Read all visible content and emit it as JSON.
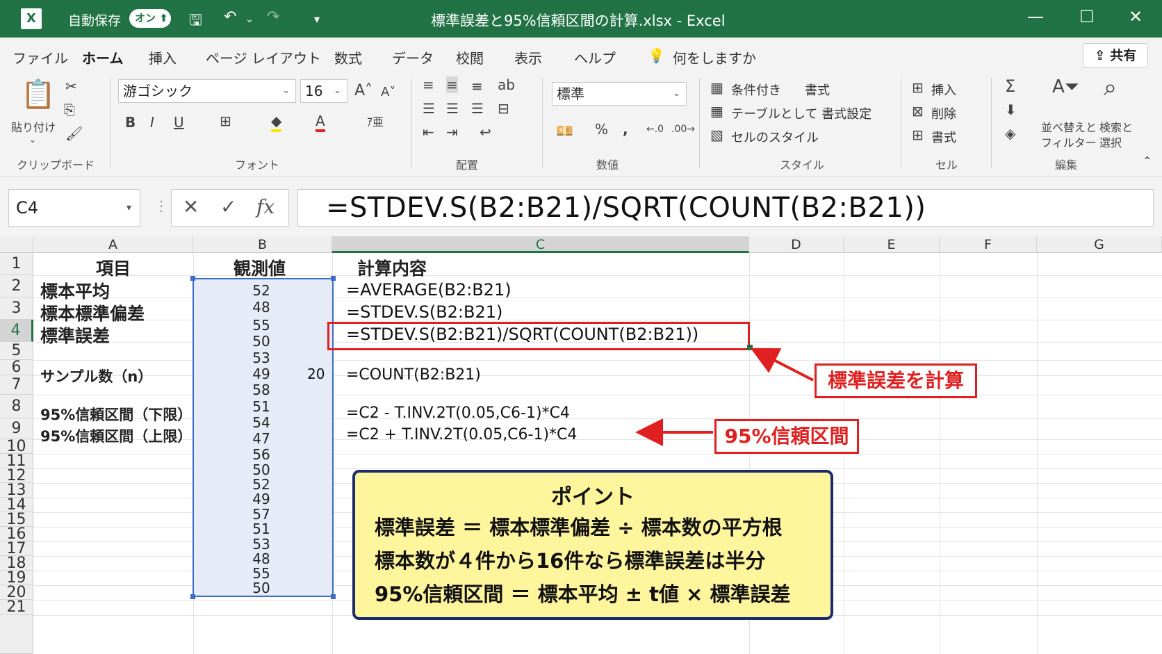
{
  "titlebar": {
    "autosave_label": "自動保存",
    "autosave_toggle": "オン",
    "file_title": "標準誤差と95%信頼区間の計算.xlsx  -  Excel"
  },
  "tabs": [
    "ファイル",
    "ホーム",
    "挿入",
    "ページ レイアウト",
    "数式",
    "データ",
    "校閲",
    "表示",
    "ヘルプ"
  ],
  "tellme": "何をしますか",
  "share_label": "共有",
  "ribbon": {
    "paste_label": "貼り付け",
    "clipboard_label": "クリップボード",
    "font_name": "游ゴシック",
    "font_size": "16",
    "font_group_label": "フォント",
    "align_group_label": "配置",
    "number_format": "標準",
    "number_group_label": "数値",
    "cond_format": "条件付き",
    "format_label": "書式",
    "table_format": "テーブルとして 書式設定",
    "cell_styles": "セルのスタイル",
    "style_group_label": "スタイル",
    "insert_label": "挿入",
    "delete_label": "削除",
    "format_cells_label": "書式",
    "cells_group_label": "セル",
    "sort_filter_1": "並べ替えと",
    "sort_filter_2": "フィルター",
    "find_select_1": "検索と",
    "find_select_2": "選択",
    "edit_group_label": "編集"
  },
  "formula_bar": {
    "namebox": "C4",
    "formula": "=STDEV.S(B2:B21)/SQRT(COUNT(B2:B21))"
  },
  "columns": [
    "A",
    "B",
    "C",
    "D",
    "E",
    "F",
    "G"
  ],
  "rows": [
    "1",
    "2",
    "3",
    "4",
    "5",
    "6",
    "7",
    "8",
    "9",
    "10",
    "11",
    "12",
    "13",
    "14",
    "15",
    "16",
    "17",
    "18",
    "19",
    "20",
    "21"
  ],
  "col_a": {
    "header": "項目",
    "r2": "標本平均",
    "r3": "標本標準偏差",
    "r4": "標準誤差",
    "r6": "サンプル数（n）",
    "r8": "95%信頼区間（下限）",
    "r9": "95%信頼区間（上限）"
  },
  "col_b_header": "観測値",
  "observations": [
    "52",
    "48",
    "55",
    "50",
    "53",
    "49",
    "58",
    "51",
    "54",
    "47",
    "56",
    "50",
    "52",
    "49",
    "57",
    "51",
    "53",
    "48",
    "55",
    "50"
  ],
  "count_value": "20",
  "col_c": {
    "header": "計算内容",
    "r2": "=AVERAGE(B2:B21)",
    "r3": "=STDEV.S(B2:B21)",
    "r4": "=STDEV.S(B2:B21)/SQRT(COUNT(B2:B21))",
    "r6": "=COUNT(B2:B21)",
    "r8": "=C2 - T.INV.2T(0.05,C6-1)*C4",
    "r9": "=C2 + T.INV.2T(0.05,C6-1)*C4"
  },
  "callouts": {
    "se": "標準誤差を計算",
    "ci": "95%信頼区間"
  },
  "point": {
    "heading": "ポイント",
    "line1": "標準誤差 ＝ 標本標準偏差 ÷ 標本数の平方根",
    "line2": "標本数が４件から16件なら標準誤差は半分",
    "line3": "95%信頼区間 ＝ 標本平均 ± t値 × 標準誤差"
  }
}
